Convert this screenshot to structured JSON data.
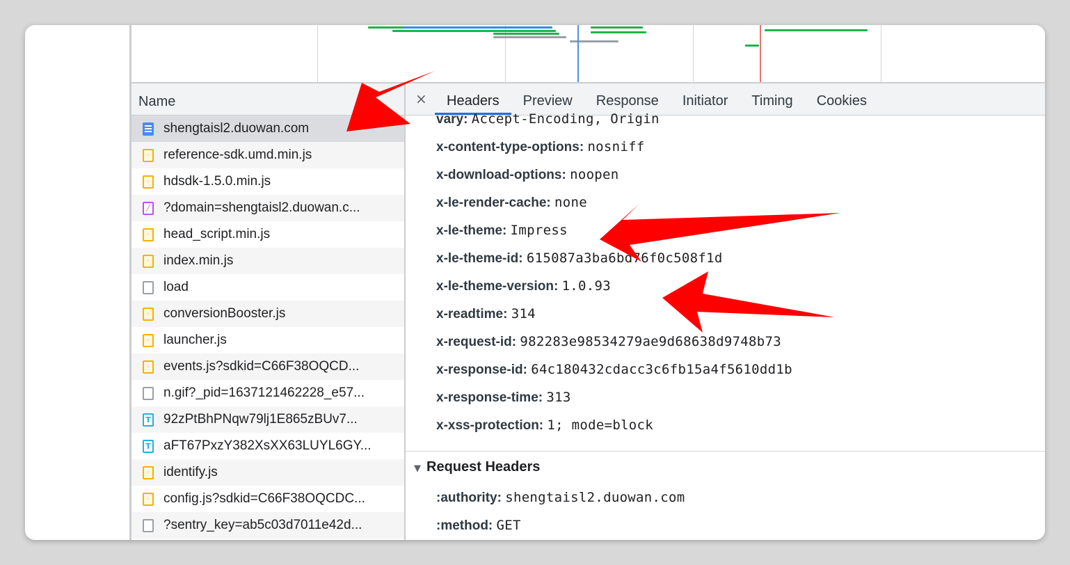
{
  "name_panel": {
    "header": "Name",
    "requests": [
      {
        "name": "shengtaisl2.duowan.com",
        "icon": "document-icon",
        "type": "doc"
      },
      {
        "name": "reference-sdk.umd.min.js",
        "icon": "script-icon",
        "type": "js"
      },
      {
        "name": "hdsdk-1.5.0.min.js",
        "icon": "script-icon",
        "type": "js"
      },
      {
        "name": "?domain=shengtaisl2.duowan.c...",
        "icon": "fetch-icon",
        "type": "fetch"
      },
      {
        "name": "head_script.min.js",
        "icon": "script-icon",
        "type": "js"
      },
      {
        "name": "index.min.js",
        "icon": "script-icon",
        "type": "js"
      },
      {
        "name": "load",
        "icon": "blank-file-icon",
        "type": "plain"
      },
      {
        "name": "conversionBooster.js",
        "icon": "script-icon",
        "type": "js"
      },
      {
        "name": "launcher.js",
        "icon": "script-icon",
        "type": "js"
      },
      {
        "name": "events.js?sdkid=C66F38OQCD...",
        "icon": "script-icon",
        "type": "js"
      },
      {
        "name": "n.gif?_pid=1637121462228_e57...",
        "icon": "blank-file-icon",
        "type": "plain"
      },
      {
        "name": "92zPtBhPNqw79lj1E865zBUv7...",
        "icon": "font-icon",
        "type": "font"
      },
      {
        "name": "aFT67PxzY382XsXX63LUYL6GY...",
        "icon": "font-icon",
        "type": "font"
      },
      {
        "name": "identify.js",
        "icon": "script-icon",
        "type": "js"
      },
      {
        "name": "config.js?sdkid=C66F38OQCDC...",
        "icon": "script-icon",
        "type": "js"
      },
      {
        "name": "?sentry_key=ab5c03d7011e42d...",
        "icon": "blank-file-icon",
        "type": "plain"
      }
    ]
  },
  "detail": {
    "close": "×",
    "tabs": [
      "Headers",
      "Preview",
      "Response",
      "Initiator",
      "Timing",
      "Cookies"
    ],
    "active_tab": "Headers",
    "response_headers": [
      {
        "key": "vary:",
        "value": "Accept-Encoding, Origin"
      },
      {
        "key": "x-content-type-options:",
        "value": "nosniff"
      },
      {
        "key": "x-download-options:",
        "value": "noopen"
      },
      {
        "key": "x-le-render-cache:",
        "value": "none"
      },
      {
        "key": "x-le-theme:",
        "value": "Impress"
      },
      {
        "key": "x-le-theme-id:",
        "value": "615087a3ba6bd76f0c508f1d"
      },
      {
        "key": "x-le-theme-version:",
        "value": "1.0.93"
      },
      {
        "key": "x-readtime:",
        "value": "314"
      },
      {
        "key": "x-request-id:",
        "value": "982283e98534279ae9d68638d9748b73"
      },
      {
        "key": "x-response-id:",
        "value": "64c180432cdacc3c6fb15a4f5610dd1b"
      },
      {
        "key": "x-response-time:",
        "value": "313"
      },
      {
        "key": "x-xss-protection:",
        "value": "1; mode=block"
      }
    ],
    "request_section_title": "Request Headers",
    "request_headers": [
      {
        "key": ":authority:",
        "value": "shengtaisl2.duowan.com"
      },
      {
        "key": ":method:",
        "value": "GET"
      }
    ]
  },
  "colors": {
    "annotation_arrow": "#ff0000",
    "active_tab_underline": "#1a73e8",
    "selected_row": "#dadce0",
    "timeline_green": "#1fb34a",
    "timeline_blue": "#2f8de4",
    "dom_content_loaded_marker": "#4a8fe8",
    "load_marker": "#e57373"
  }
}
